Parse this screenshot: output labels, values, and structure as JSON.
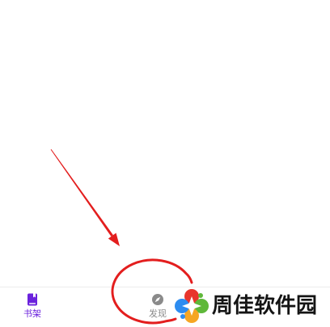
{
  "nav": {
    "tabs": [
      {
        "label": "书架",
        "icon": "book-icon",
        "active": true
      },
      {
        "label": "发现",
        "icon": "compass-icon",
        "active": false
      }
    ]
  },
  "watermark": {
    "text": "周佳软件园",
    "logo": "pinwheel-logo"
  },
  "colors": {
    "accent": "#6b22dd",
    "inactive": "#8a8a8a",
    "annotation": "#e31e1e",
    "watermark_text": "#141414",
    "background": "#ffffff"
  }
}
